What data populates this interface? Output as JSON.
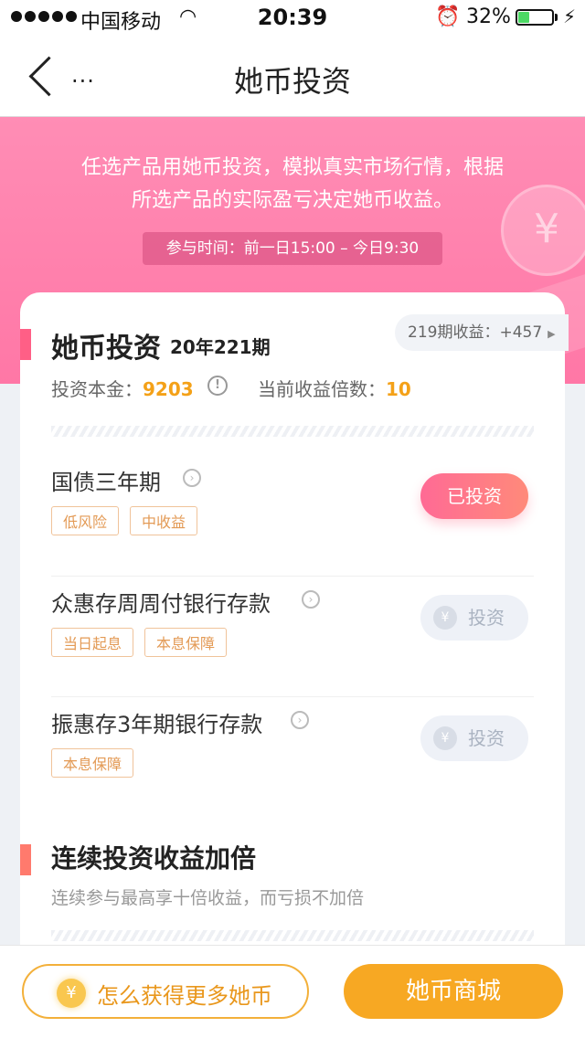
{
  "status_bar": {
    "carrier": "中国移动",
    "time": "20:39",
    "battery": "32%",
    "battery_level": 0.32
  },
  "nav": {
    "more": "...",
    "title": "她币投资"
  },
  "banner": {
    "line1": "任选产品用她币投资，模拟真实市场行情，根据",
    "line2": "所选产品的实际盈亏决定她币收益。",
    "time_label": "参与时间：前一日15:00 – 今日9:30",
    "coin_symbol": "¥"
  },
  "section1": {
    "title": "她币投资",
    "issue": "20年221期",
    "income_pill": "219期收益：+457",
    "principal_label": "投资本金：",
    "principal_value": "9203",
    "multiplier_label": "当前收益倍数：",
    "multiplier_value": "10"
  },
  "products": [
    {
      "name": "国债三年期",
      "tags": [
        "低风险",
        "中收益"
      ],
      "button": "已投资"
    },
    {
      "name": "众惠存周周付银行存款",
      "tags": [
        "当日起息",
        "本息保障"
      ],
      "button": "投资"
    },
    {
      "name": "振惠存3年期银行存款",
      "tags": [
        "本息保障"
      ],
      "button": "投资"
    }
  ],
  "section2": {
    "title": "连续投资收益加倍",
    "subtitle": "连续参与最高享十倍收益，而亏损不加倍"
  },
  "bottom": {
    "earn_label": "怎么获得更多她币",
    "mall_label": "她币商城",
    "coin_symbol": "¥"
  },
  "colors": {
    "banner_pink": "#ff80ac",
    "accent_orange": "#f7a823",
    "invested_button": "#ff6a95",
    "tag_border": "#f0c39a"
  }
}
